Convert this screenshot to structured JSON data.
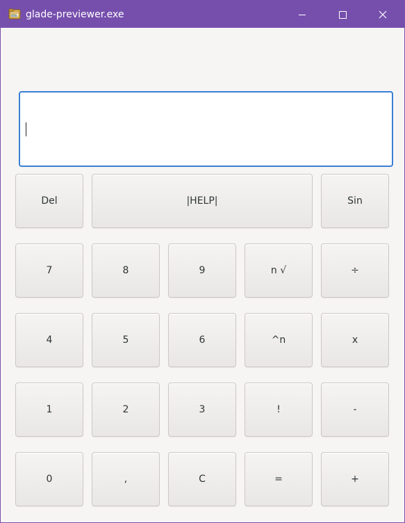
{
  "window": {
    "title": "glade-previewer.exe",
    "controls": [
      "minimize-icon",
      "maximize-icon",
      "close-icon"
    ],
    "titlebar_color": "#764fad",
    "accent_focus_color": "#3a7fd4"
  },
  "display": {
    "value": ""
  },
  "keys": {
    "row1": [
      "Del",
      "|HELP|",
      "Sin"
    ],
    "row2": [
      "7",
      "8",
      "9",
      "n √",
      "÷"
    ],
    "row3": [
      "4",
      "5",
      "6",
      "^n",
      "x"
    ],
    "row4": [
      "1",
      "2",
      "3",
      "!",
      "-"
    ],
    "row5": [
      "0",
      ",",
      "C",
      "=",
      "+"
    ]
  }
}
